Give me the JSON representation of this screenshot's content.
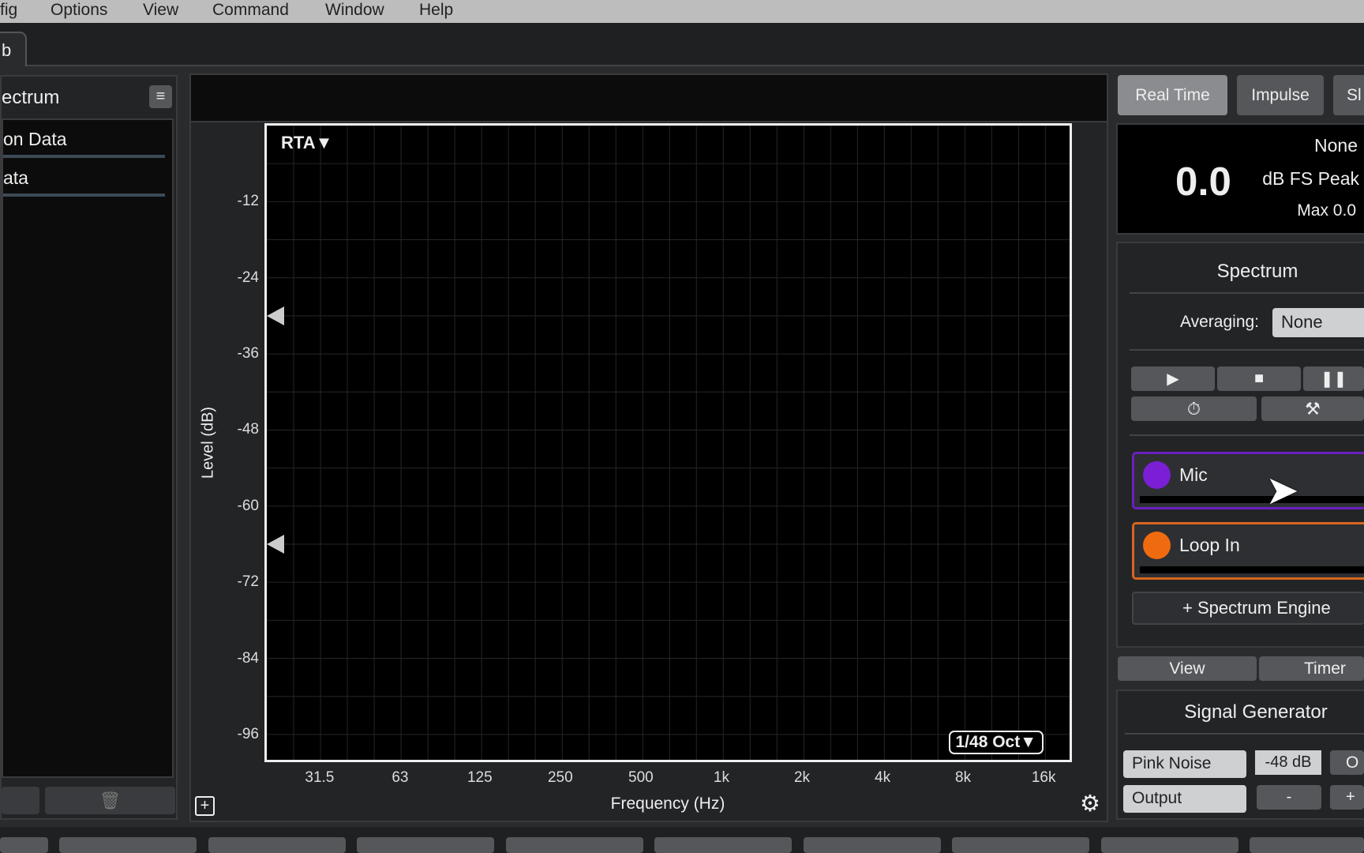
{
  "menu": [
    "fig",
    "Options",
    "View",
    "Command",
    "Window",
    "Help"
  ],
  "tab": "b",
  "left_panel": {
    "title": "ectrum",
    "items": [
      "on Data",
      "ata"
    ]
  },
  "chart_data": {
    "type": "line",
    "series": [],
    "xlabel": "Frequency (Hz)",
    "ylabel": "Level (dB)",
    "x_scale": "log",
    "xlim": [
      20,
      20000
    ],
    "ylim": [
      -100,
      0
    ],
    "x_ticks": [
      31.5,
      63,
      125,
      250,
      500,
      1000,
      2000,
      4000,
      8000,
      16000
    ],
    "x_tick_labels": [
      "31.5",
      "63",
      "125",
      "250",
      "500",
      "1k",
      "2k",
      "4k",
      "8k",
      "16k"
    ],
    "y_ticks": [
      -12,
      -24,
      -36,
      -48,
      -60,
      -72,
      -84,
      -96
    ],
    "y_tick_labels": [
      "-12",
      "-24",
      "-36",
      "-48",
      "-60",
      "-72",
      "-84",
      "-96"
    ],
    "grid": true,
    "mode_label": "RTA▼",
    "resolution_label": "1/48 Oct▼",
    "markers_db": [
      -30,
      -66
    ]
  },
  "right": {
    "tabs": [
      "Real Time",
      "Impulse",
      "Sl"
    ],
    "readout": {
      "value": "0.0",
      "avg": "None",
      "unit": "dB FS Peak",
      "max": "Max 0.0"
    },
    "spectrum": {
      "title": "Spectrum",
      "averaging_label": "Averaging:",
      "averaging_value": "None",
      "add_engine": "+ Spectrum Engine"
    },
    "engines": [
      {
        "name": "Mic",
        "color": "#7a1fd6"
      },
      {
        "name": "Loop In",
        "color": "#f06a10"
      }
    ],
    "subtabs": [
      "View",
      "Timer"
    ],
    "siggen": {
      "title": "Signal Generator",
      "type": "Pink Noise",
      "level": "-48 dB",
      "on": "O",
      "output": "Output",
      "minus": "-",
      "plus": "+"
    }
  },
  "colors": {
    "accent_mic": "#7a1fd6",
    "accent_loop": "#f06a10"
  }
}
